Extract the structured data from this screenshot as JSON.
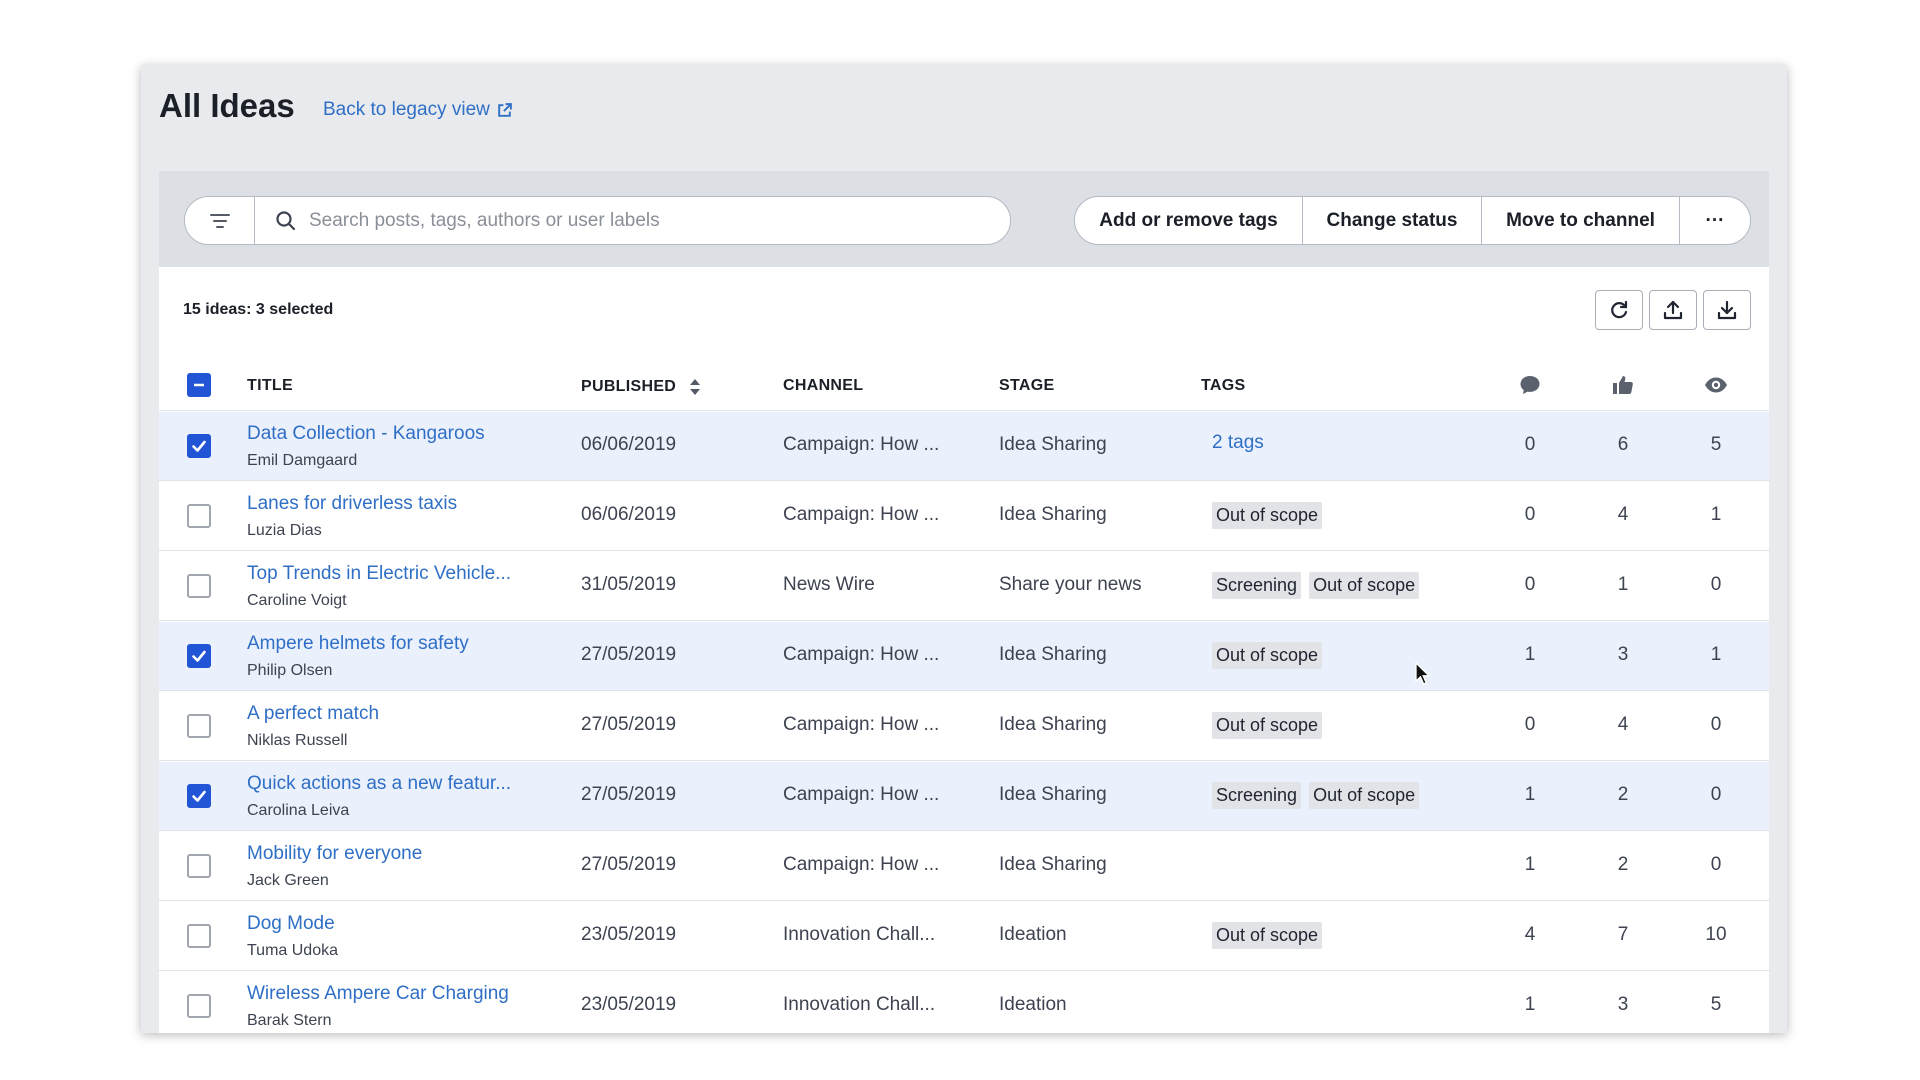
{
  "header": {
    "title": "All Ideas",
    "legacy_link": "Back to legacy view"
  },
  "search": {
    "placeholder": "Search posts, tags, authors or user labels"
  },
  "actions": {
    "add_remove_tags": "Add or remove tags",
    "change_status": "Change status",
    "move_to_channel": "Move to channel",
    "more": "···"
  },
  "summary": {
    "count_label": "15 ideas: 3 selected"
  },
  "columns": {
    "title": "TITLE",
    "published": "PUBLISHED",
    "channel": "CHANNEL",
    "stage": "STAGE",
    "tags": "TAGS"
  },
  "colors": {
    "accent": "#2255d6",
    "link": "#2f6fc6",
    "selected_row": "#eaf0fc"
  },
  "rows": [
    {
      "title": "Data Collection - Kangaroos",
      "author": "Emil Damgaard",
      "published": "06/06/2019",
      "channel": "Campaign: How ...",
      "stage": "Idea Sharing",
      "tags": [],
      "tags_link": "2 tags",
      "comments": "0",
      "likes": "6",
      "views": "5",
      "selected": true
    },
    {
      "title": "Lanes for driverless taxis",
      "author": "Luzia Dias",
      "published": "06/06/2019",
      "channel": "Campaign: How ...",
      "stage": "Idea Sharing",
      "tags": [
        "Out of scope"
      ],
      "tags_link": "",
      "comments": "0",
      "likes": "4",
      "views": "1",
      "selected": false
    },
    {
      "title": "Top Trends in Electric Vehicle...",
      "author": "Caroline Voigt",
      "published": "31/05/2019",
      "channel": "News Wire",
      "stage": "Share your news",
      "tags": [
        "Screening",
        "Out of scope"
      ],
      "tags_link": "",
      "comments": "0",
      "likes": "1",
      "views": "0",
      "selected": false
    },
    {
      "title": "Ampere helmets for safety",
      "author": "Philip Olsen",
      "published": "27/05/2019",
      "channel": "Campaign: How ...",
      "stage": "Idea Sharing",
      "tags": [
        "Out of scope"
      ],
      "tags_link": "",
      "comments": "1",
      "likes": "3",
      "views": "1",
      "selected": true
    },
    {
      "title": "A perfect match",
      "author": "Niklas Russell",
      "published": "27/05/2019",
      "channel": "Campaign: How ...",
      "stage": "Idea Sharing",
      "tags": [
        "Out of scope"
      ],
      "tags_link": "",
      "comments": "0",
      "likes": "4",
      "views": "0",
      "selected": false
    },
    {
      "title": "Quick actions as a new featur...",
      "author": "Carolina Leiva",
      "published": "27/05/2019",
      "channel": "Campaign: How ...",
      "stage": "Idea Sharing",
      "tags": [
        "Screening",
        "Out of scope"
      ],
      "tags_link": "",
      "comments": "1",
      "likes": "2",
      "views": "0",
      "selected": true
    },
    {
      "title": "Mobility for everyone",
      "author": "Jack Green",
      "published": "27/05/2019",
      "channel": "Campaign: How ...",
      "stage": "Idea Sharing",
      "tags": [],
      "tags_link": "",
      "comments": "1",
      "likes": "2",
      "views": "0",
      "selected": false
    },
    {
      "title": "Dog Mode",
      "author": "Tuma Udoka",
      "published": "23/05/2019",
      "channel": "Innovation Chall...",
      "stage": "Ideation",
      "tags": [
        "Out of scope"
      ],
      "tags_link": "",
      "comments": "4",
      "likes": "7",
      "views": "10",
      "selected": false
    },
    {
      "title": "Wireless Ampere Car Charging",
      "author": "Barak Stern",
      "published": "23/05/2019",
      "channel": "Innovation Chall...",
      "stage": "Ideation",
      "tags": [],
      "tags_link": "",
      "comments": "1",
      "likes": "3",
      "views": "5",
      "selected": false
    }
  ]
}
